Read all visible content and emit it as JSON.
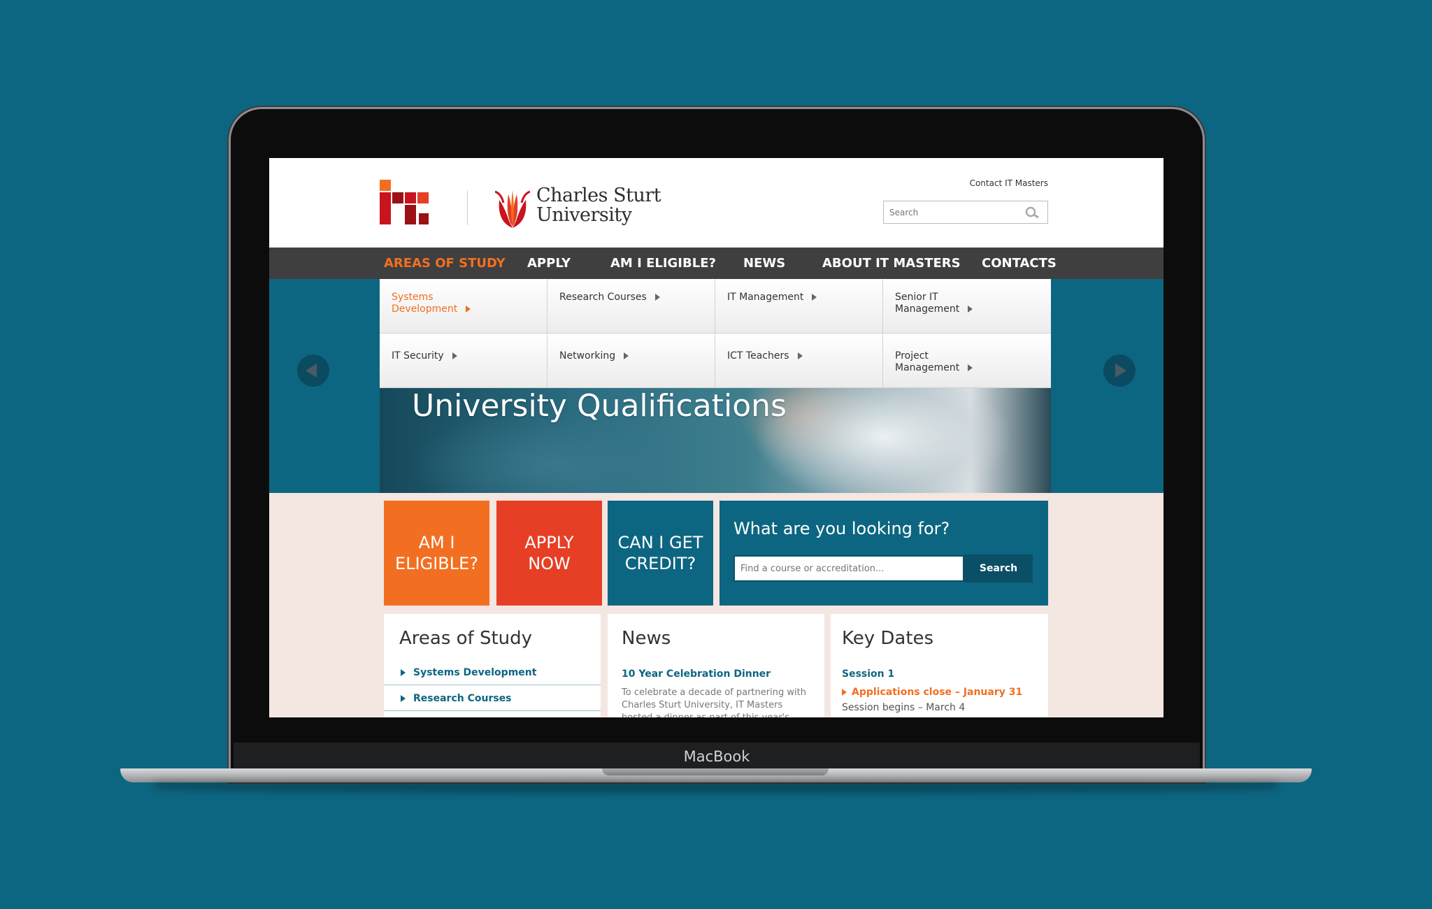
{
  "device": {
    "label": "MacBook"
  },
  "header": {
    "university_name_line1": "Charles Sturt",
    "university_name_line2": "University",
    "contact_link": "Contact IT Masters",
    "search_placeholder": "Search"
  },
  "nav": {
    "items": [
      {
        "label": "AREAS OF STUDY",
        "active": true
      },
      {
        "label": "APPLY"
      },
      {
        "label": "AM I ELIGIBLE?"
      },
      {
        "label": "NEWS"
      },
      {
        "label": "ABOUT IT MASTERS"
      },
      {
        "label": "CONTACTS"
      }
    ]
  },
  "dropdown": {
    "items": [
      {
        "line1": "Systems",
        "line2": "Development",
        "active": true
      },
      {
        "line1": "Research Courses"
      },
      {
        "line1": "IT Management"
      },
      {
        "line1": "Senior IT",
        "line2": "Management"
      },
      {
        "line1": "IT Security"
      },
      {
        "line1": "Networking"
      },
      {
        "line1": "ICT Teachers"
      },
      {
        "line1": "Project",
        "line2": "Management"
      }
    ]
  },
  "hero": {
    "title": "University Qualifications"
  },
  "tiles": [
    {
      "line1": "AM I",
      "line2": "ELIGIBLE?",
      "color": "#f26f21"
    },
    {
      "line1": "APPLY",
      "line2": "NOW",
      "color": "#e63f25"
    },
    {
      "line1": "CAN I GET",
      "line2": "CREDIT?",
      "color": "#0d6681"
    }
  ],
  "finder": {
    "title": "What are you looking for?",
    "placeholder": "Find a course or accreditation...",
    "button": "Search"
  },
  "areas_of_study": {
    "title": "Areas of Study",
    "links": [
      "Systems Development",
      "Research Courses"
    ]
  },
  "news": {
    "title": "News",
    "headline": "10 Year Celebration Dinner",
    "body": "To celebrate a decade of partnering with Charles Sturt University, IT Masters hosted a dinner as part of this year's"
  },
  "key_dates": {
    "title": "Key Dates",
    "session": "Session 1",
    "applications_close": "Applications close – January 31",
    "session_begins": "Session begins – March 4"
  },
  "colors": {
    "background": "#0d6681",
    "accent_orange": "#f26f21",
    "accent_red": "#e63f25",
    "nav_bar": "#3f3f3f",
    "page_tint": "#f4e6e1"
  }
}
